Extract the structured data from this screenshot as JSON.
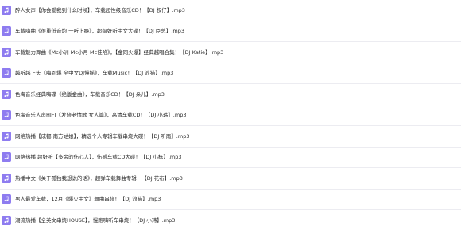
{
  "files": [
    {
      "name": "醉人女声【你会爱我到什么时候】，车载超性级音乐CD！【DJ 权仔】.mp3",
      "icon": "music-file-icon",
      "icon_color": "#8e7cf0"
    },
    {
      "name": "车载嗨曲《很重低音炮 一听上瘾》，超级好听中文大碟！【DJ 臣总】.mp3",
      "icon": "music-file-icon",
      "icon_color": "#8e7cf0"
    },
    {
      "name": "车载魅力舞曲《Mc小洲 Mc小月 Mc佳哈》，【金同火爆】经典越唱合集！【DJ Katie】.mp3",
      "icon": "music-file-icon",
      "icon_color": "#8e7cf0"
    },
    {
      "name": "越听越上头《嗨到爆 全中文DJ慢摇》，车载Music！【DJ 浪猫】.mp3",
      "icon": "music-file-icon",
      "icon_color": "#8e7cf0"
    },
    {
      "name": "色海音乐经典嗨碟《绝版金曲》，车载音乐CD！【DJ 朵儿】.mp3",
      "icon": "music-file-icon",
      "icon_color": "#8e7cf0"
    },
    {
      "name": "色海音乐人声HIFI《发烧老情歌 女人篇》，高清车载CD！【DJ 小玮】.mp3",
      "icon": "music-file-icon",
      "icon_color": "#8e7cf0"
    },
    {
      "name": "网络热播【成都 南方姑娘】，精选个人专辑车载串烧大碟！【DJ 听雨】.mp3",
      "icon": "music-file-icon",
      "icon_color": "#8e7cf0"
    },
    {
      "name": "网络热播 超好听【多余的伤心人】，伤感车载CD大碟！【DJ 小栋】.mp3",
      "icon": "music-file-icon",
      "icon_color": "#8e7cf0"
    },
    {
      "name": "热播中文《关于孤独我想说的话》，超弹车载舞曲专辑！【DJ 花布】.mp3",
      "icon": "music-file-icon",
      "icon_color": "#8e7cf0"
    },
    {
      "name": "男人最爱车载，12月《爆火中文》舞曲串烧！【DJ 浪猫】.mp3",
      "icon": "music-file-icon",
      "icon_color": "#8e7cf0"
    },
    {
      "name": "潮流热播【全英文串烧HOUSE】，慢跑嗨听车串烧！【DJ 小玮】.mp3",
      "icon": "music-file-icon",
      "icon_color": "#8e7cf0"
    }
  ]
}
